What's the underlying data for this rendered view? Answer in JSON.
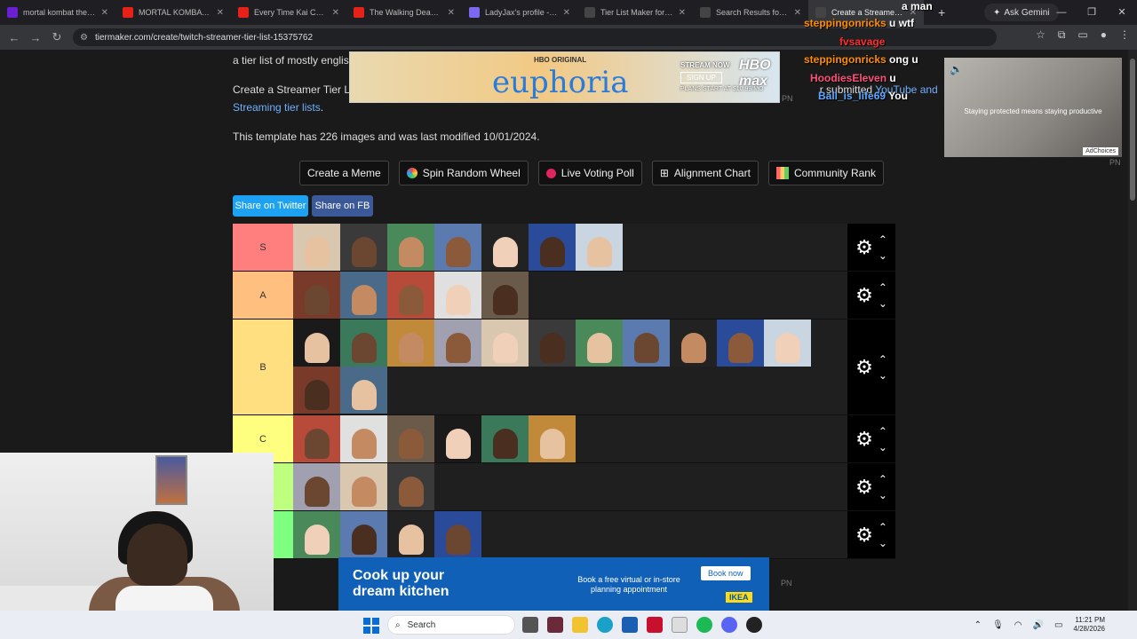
{
  "browser": {
    "tabs": [
      {
        "title": "mortal kombat the arm",
        "color": "#6a1fd1"
      },
      {
        "title": "MORTAL KOMBAT DEC",
        "color": "#e62117"
      },
      {
        "title": "Every Time Kai Cenat R",
        "color": "#e62117"
      },
      {
        "title": "The Walking Dead: Epi",
        "color": "#e62117"
      },
      {
        "title": "LadyJax's profile - E-Pal",
        "color": "#7b68ee"
      },
      {
        "title": "Tier List Maker for Ever",
        "color": "#444"
      },
      {
        "title": "Search Results for 'stre",
        "color": "#444"
      },
      {
        "title": "Create a Streamer Tie",
        "color": "#444"
      }
    ],
    "ask_gemini": "Ask Gemini",
    "url": "tiermaker.com/create/twitch-streamer-tier-list-15375762"
  },
  "page": {
    "desc_line1": "a tier list of mostly english",
    "desc_line2_a": "Create a Streamer Tier Lis",
    "desc_line2_b": "r submitted ",
    "desc_link_youtube": "YouTube and",
    "desc_link_streaming": "Streaming tier lists",
    "desc_period": ".",
    "template_info": "This template has 226 images and was last modified 10/01/2024.",
    "buttons": {
      "meme": "Create a Meme",
      "wheel": "Spin Random Wheel",
      "poll": "Live Voting Poll",
      "alignment": "Alignment Chart",
      "community": "Community Rank"
    },
    "share_twitter": "Share on Twitter",
    "share_fb": "Share on FB"
  },
  "tiers": [
    {
      "label": "S",
      "color": "#ff7f7f",
      "count": 7
    },
    {
      "label": "A",
      "color": "#ffbf7f",
      "count": 5
    },
    {
      "label": "B",
      "color": "#ffdf7f",
      "count": 13
    },
    {
      "label": "C",
      "color": "#ffff7f",
      "count": 6
    },
    {
      "label": "",
      "color": "#bfff7f",
      "count": 3
    },
    {
      "label": "",
      "color": "#7fff7f",
      "count": 4
    }
  ],
  "ads": {
    "top": {
      "hbo": "HBO ORIGINAL",
      "brand": "euphoria",
      "stream_now": "STREAM NOW",
      "sign_up": "SIGN UP",
      "plans": "PLANS START AT $10.99/MO",
      "logo": "HBO max"
    },
    "side": {
      "caption": "Staying protected means staying productive",
      "adchoices": "AdChoices"
    },
    "bottom": {
      "headline_1": "Cook up your",
      "headline_2": "dream kitchen",
      "sub": "Book a free virtual or in-store planning appointment",
      "cta": "Book now",
      "logo": "IKEA"
    },
    "pn": "PN"
  },
  "chat": [
    {
      "user": "",
      "msg": "a man",
      "color": "#ffffff"
    },
    {
      "user": "steppingonricks",
      "msg": "u wtf",
      "color": "#ff8c00"
    },
    {
      "user": "fvsavage",
      "msg": "",
      "color": "#ff2d2d"
    },
    {
      "user": "steppingonricks",
      "msg": "ong u",
      "color": "#ff8c00"
    },
    {
      "user": "HoodiesEleven",
      "msg": "u",
      "color": "#ff4f7a"
    },
    {
      "user": "Ball_is_life69",
      "msg": "You",
      "color": "#5fa8ff"
    }
  ],
  "taskbar": {
    "search": "Search",
    "time": "11:21 PM",
    "date": "4/28/2026"
  }
}
